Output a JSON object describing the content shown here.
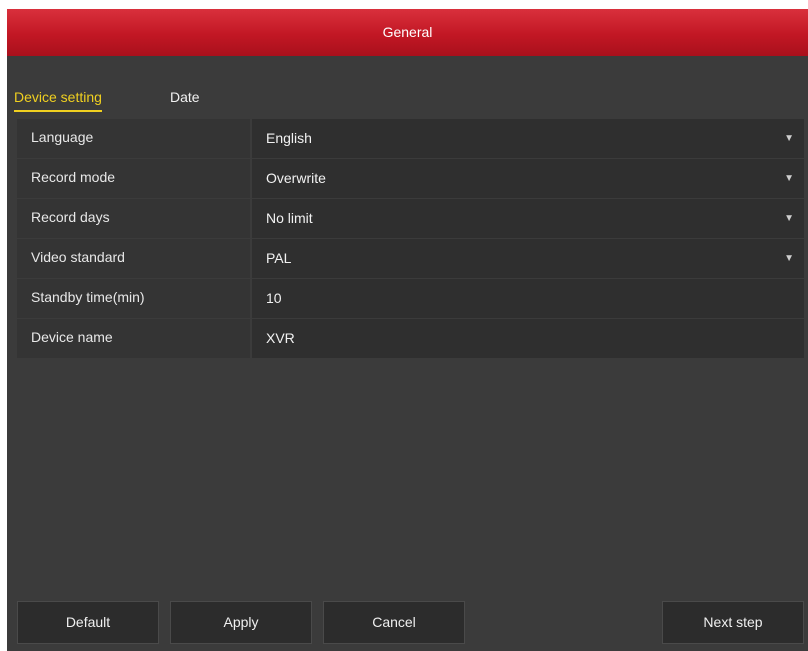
{
  "window": {
    "title": "General"
  },
  "tabs": [
    {
      "label": "Device setting",
      "active": true
    },
    {
      "label": "Date",
      "active": false
    }
  ],
  "settings": [
    {
      "label": "Language",
      "value": "English",
      "type": "dropdown"
    },
    {
      "label": "Record mode",
      "value": "Overwrite",
      "type": "dropdown"
    },
    {
      "label": "Record days",
      "value": "No limit",
      "type": "dropdown"
    },
    {
      "label": "Video standard",
      "value": "PAL",
      "type": "dropdown"
    },
    {
      "label": "Standby time(min)",
      "value": "10",
      "type": "text"
    },
    {
      "label": "Device name",
      "value": "XVR",
      "type": "text"
    }
  ],
  "buttons": {
    "default_label": "Default",
    "apply_label": "Apply",
    "cancel_label": "Cancel",
    "next_label": "Next step"
  },
  "icons": {
    "dropdown": "chevron-down-icon"
  },
  "colors": {
    "titlebar": "#c21724",
    "active_tab": "#f0d020",
    "background": "#3b3b3b"
  }
}
